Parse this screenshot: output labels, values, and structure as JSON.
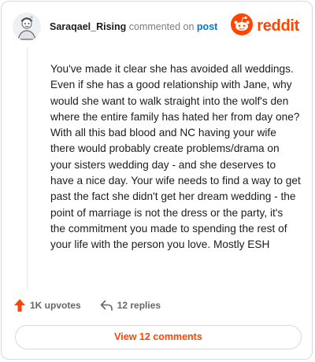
{
  "comment": {
    "username": "Saraqael_Rising",
    "action_text": "commented on",
    "target_label": "post",
    "body": "You've made it clear she has avoided all weddings. Even if she has a good relationship with Jane, why would she want to walk straight into the wolf's den where the entire family has hated her from day one? With all this bad blood and NC having your wife there would probably create problems/drama on your sisters wedding day - and she deserves to have a nice day. Your wife needs to find a way to get past the fact she didn't get her dream wedding - the point of marriage is not the dress or the party, it's the commitment you made to spending the rest of your life with the person you love. Mostly ESH"
  },
  "brand": {
    "name": "reddit",
    "color": "#ff4500",
    "icon": "reddit-snoo-icon"
  },
  "actions": {
    "upvotes_label": "1K upvotes",
    "upvote_icon": "upvote-arrow-icon",
    "replies_label": "12 replies",
    "reply_icon": "reply-arrow-icon"
  },
  "footer": {
    "view_comments_label": "View 12 comments"
  },
  "colors": {
    "accent": "#ff4500",
    "link": "#0079d3",
    "muted_text": "#7c7c7c",
    "border": "#d7dadc"
  }
}
